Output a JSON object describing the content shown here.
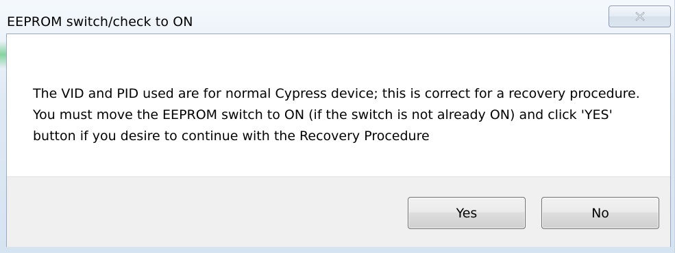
{
  "dialog": {
    "title": "EEPROM switch/check to ON",
    "message": "The VID and PID used are for normal Cypress device; this is correct for a recovery procedure. You must move the EEPROM switch to ON (if the switch is not already ON) and click 'YES' button if you desire to continue with the Recovery Procedure",
    "buttons": {
      "yes_label": "Yes",
      "no_label": "No"
    },
    "close_icon": "close-icon"
  }
}
